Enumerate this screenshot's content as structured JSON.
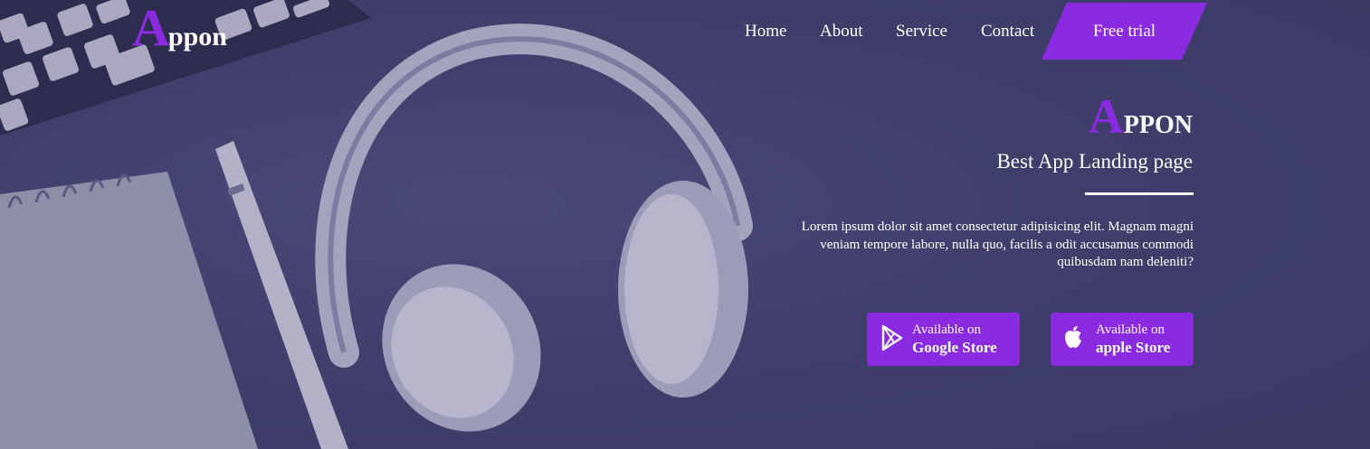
{
  "logo": {
    "initial": "A",
    "rest": "ppon"
  },
  "nav": {
    "items": [
      {
        "label": "Home"
      },
      {
        "label": "About"
      },
      {
        "label": "Service"
      },
      {
        "label": "Contact"
      }
    ],
    "cta_label": "Free trial"
  },
  "hero": {
    "brand_initial": "A",
    "brand_rest": "PPON",
    "tagline": "Best App Landing page",
    "description": "Lorem ipsum dolor sit amet consectetur adipisicing elit. Magnam magni veniam tempore labore, nulla quo, facilis a odit accusamus commodi quibusdam nam deleniti?"
  },
  "stores": {
    "google": {
      "small": "Available on",
      "big": "Google Store",
      "icon": "play-store-icon"
    },
    "apple": {
      "small": "Available on",
      "big": "apple Store",
      "icon": "apple-icon"
    }
  },
  "colors": {
    "accent": "#8a2be2",
    "background": "#3f3e6b",
    "text": "#ffffff"
  }
}
